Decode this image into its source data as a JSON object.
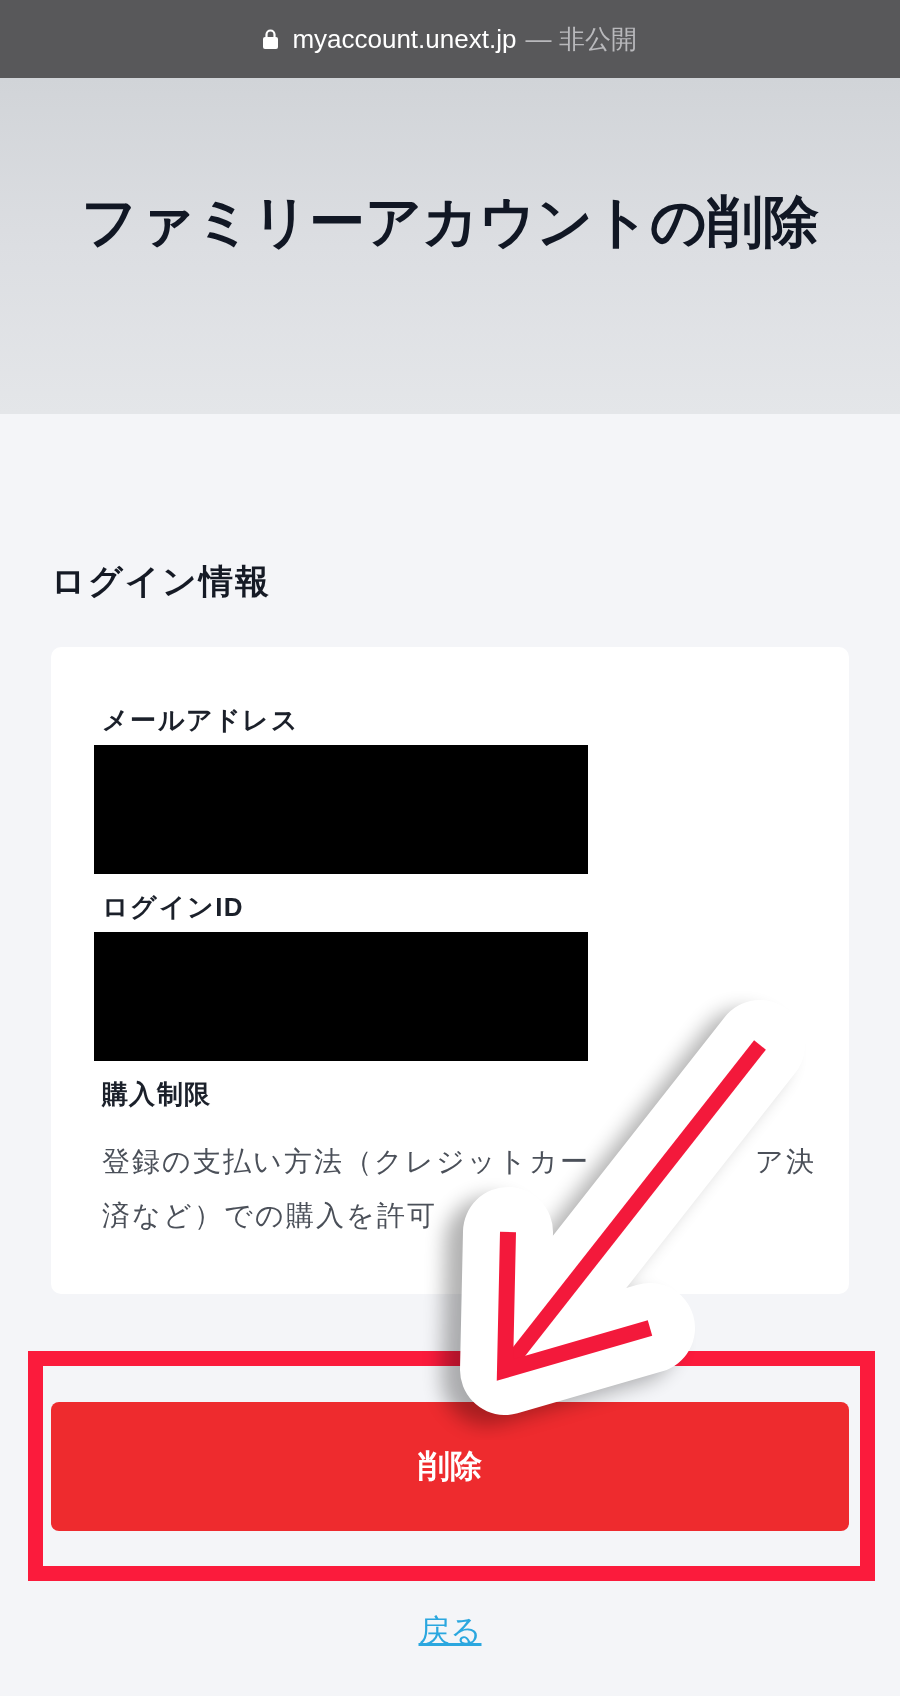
{
  "address_bar": {
    "url": "myaccount.unext.jp",
    "note": "— 非公開"
  },
  "header": {
    "title": "ファミリーアカウントの削除"
  },
  "login_info": {
    "heading": "ログイン情報",
    "fields": [
      {
        "kind": "redacted",
        "label": "メールアドレス"
      },
      {
        "kind": "redacted",
        "label": "ログインID"
      },
      {
        "kind": "text",
        "label": "購入制限",
        "lines": [
          {
            "parts": [
              "登録の支払い方法（クレジットカー",
              "ア決"
            ]
          },
          {
            "parts": [
              "済など）での購入を許可"
            ]
          }
        ]
      }
    ]
  },
  "delete_button": {
    "label": "削除"
  },
  "back_link": {
    "label": "戻る"
  }
}
